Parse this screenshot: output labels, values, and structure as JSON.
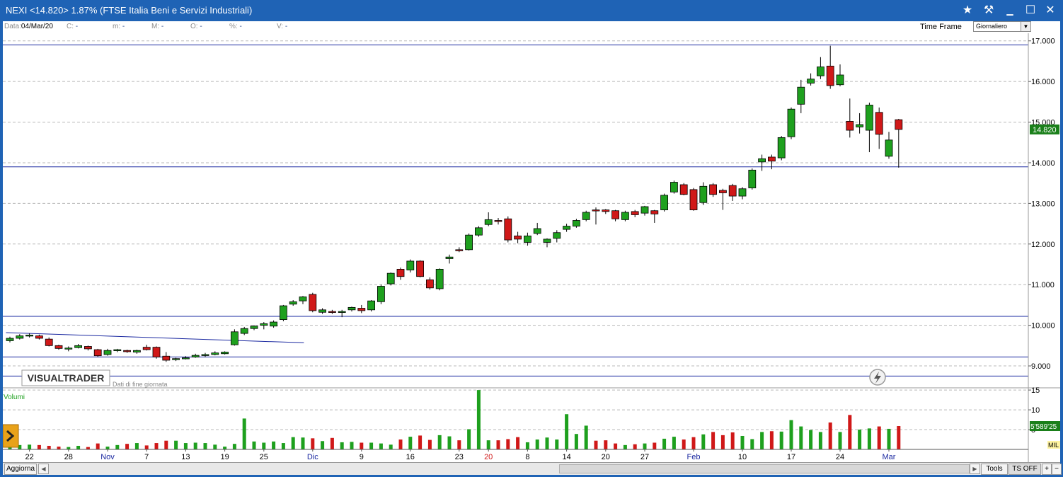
{
  "window": {
    "title": "NEXI <14.820> 1.87%  (FTSE Italia Beni e Servizi Industriali)",
    "controls": {
      "star": "★",
      "tool": "⚒",
      "minimize": "▁",
      "maximize": "☐",
      "close": "✕"
    }
  },
  "infobar": {
    "date_label": "Data:",
    "date_value": "04/Mar/20",
    "c_label": "C:",
    "c_value": "-",
    "m_low_label": "m:",
    "m_low_value": "-",
    "m_high_label": "M:",
    "m_high_value": "-",
    "o_label": "O:",
    "o_value": "-",
    "pct_label": "%:",
    "pct_value": "-",
    "v_label": "V:",
    "v_value": "-",
    "timeframe_label": "Time Frame",
    "timeframe_value": "Giornaliero"
  },
  "watermark": {
    "logo": "VISUALTRADER",
    "subtitle": "Dati di fine giornata"
  },
  "bottombar": {
    "refresh": "Aggiorna",
    "tools": "Tools",
    "ts_off": "TS OFF",
    "plus": "+",
    "minus": "−"
  },
  "colors": {
    "up": "#1ea01e",
    "down": "#d01818",
    "line": "#1a28a0",
    "grid": "#b8b8b8",
    "accent": "#1f63b5"
  },
  "chart_data": [
    {
      "type": "candlestick",
      "ylim": [
        8.6,
        17.1
      ],
      "yticks": [
        9.0,
        10.0,
        11.0,
        12.0,
        13.0,
        14.0,
        15.0,
        16.0,
        17.0
      ],
      "ytick_labels": [
        "9.000",
        "10.000",
        "11.000",
        "12.000",
        "13.000",
        "14.000",
        "15.000",
        "16.000",
        "17.000"
      ],
      "last_price_label": "14.820",
      "x_labels": [
        {
          "i": 2,
          "label": "22",
          "color": "#000"
        },
        {
          "i": 6,
          "label": "28",
          "color": "#000"
        },
        {
          "i": 10,
          "label": "Nov",
          "color": "#1a28a0"
        },
        {
          "i": 14,
          "label": "7",
          "color": "#000"
        },
        {
          "i": 18,
          "label": "13",
          "color": "#000"
        },
        {
          "i": 22,
          "label": "19",
          "color": "#000"
        },
        {
          "i": 26,
          "label": "25",
          "color": "#000"
        },
        {
          "i": 31,
          "label": "Dic",
          "color": "#1a28a0"
        },
        {
          "i": 36,
          "label": "9",
          "color": "#000"
        },
        {
          "i": 41,
          "label": "16",
          "color": "#000"
        },
        {
          "i": 46,
          "label": "23",
          "color": "#000"
        },
        {
          "i": 49,
          "label": "20",
          "color": "#d01818"
        },
        {
          "i": 53,
          "label": "8",
          "color": "#000"
        },
        {
          "i": 57,
          "label": "14",
          "color": "#000"
        },
        {
          "i": 61,
          "label": "20",
          "color": "#000"
        },
        {
          "i": 65,
          "label": "27",
          "color": "#000"
        },
        {
          "i": 70,
          "label": "Feb",
          "color": "#1a28a0"
        },
        {
          "i": 75,
          "label": "10",
          "color": "#000"
        },
        {
          "i": 80,
          "label": "17",
          "color": "#000"
        },
        {
          "i": 85,
          "label": "24",
          "color": "#000"
        },
        {
          "i": 90,
          "label": "Mar",
          "color": "#1a28a0"
        }
      ],
      "horizontal_lines": [
        16.9,
        13.9,
        10.22,
        9.22,
        8.75
      ],
      "trendline": {
        "from": [
          -0.4,
          9.82
        ],
        "to": [
          30.1,
          9.57
        ]
      },
      "ohlc": [
        [
          9.62,
          9.72,
          9.58,
          9.68
        ],
        [
          9.68,
          9.78,
          9.65,
          9.74
        ],
        [
          9.74,
          9.8,
          9.7,
          9.76
        ],
        [
          9.74,
          9.77,
          9.65,
          9.68
        ],
        [
          9.66,
          9.7,
          9.48,
          9.5
        ],
        [
          9.5,
          9.52,
          9.4,
          9.43
        ],
        [
          9.42,
          9.48,
          9.36,
          9.44
        ],
        [
          9.45,
          9.54,
          9.43,
          9.5
        ],
        [
          9.48,
          9.5,
          9.38,
          9.42
        ],
        [
          9.4,
          9.42,
          9.22,
          9.25
        ],
        [
          9.28,
          9.42,
          9.25,
          9.38
        ],
        [
          9.38,
          9.42,
          9.34,
          9.4
        ],
        [
          9.38,
          9.4,
          9.32,
          9.35
        ],
        [
          9.34,
          9.4,
          9.3,
          9.38
        ],
        [
          9.46,
          9.52,
          9.38,
          9.4
        ],
        [
          9.46,
          9.48,
          9.18,
          9.22
        ],
        [
          9.24,
          9.34,
          9.1,
          9.14
        ],
        [
          9.16,
          9.2,
          9.12,
          9.18
        ],
        [
          9.18,
          9.24,
          9.16,
          9.2
        ],
        [
          9.22,
          9.3,
          9.2,
          9.26
        ],
        [
          9.26,
          9.32,
          9.22,
          9.28
        ],
        [
          9.28,
          9.36,
          9.26,
          9.32
        ],
        [
          9.3,
          9.36,
          9.28,
          9.34
        ],
        [
          9.52,
          9.9,
          9.5,
          9.84
        ],
        [
          9.8,
          9.96,
          9.76,
          9.92
        ],
        [
          9.92,
          10.0,
          9.88,
          9.98
        ],
        [
          10.0,
          10.08,
          9.9,
          10.04
        ],
        [
          9.98,
          10.12,
          9.94,
          10.08
        ],
        [
          10.14,
          10.5,
          10.1,
          10.48
        ],
        [
          10.52,
          10.62,
          10.48,
          10.58
        ],
        [
          10.6,
          10.72,
          10.52,
          10.7
        ],
        [
          10.76,
          10.8,
          10.32,
          10.36
        ],
        [
          10.32,
          10.42,
          10.28,
          10.38
        ],
        [
          10.34,
          10.38,
          10.28,
          10.32
        ],
        [
          10.32,
          10.38,
          10.2,
          10.34
        ],
        [
          10.38,
          10.46,
          10.34,
          10.44
        ],
        [
          10.42,
          10.5,
          10.3,
          10.36
        ],
        [
          10.38,
          10.62,
          10.34,
          10.6
        ],
        [
          10.58,
          11.0,
          10.52,
          10.96
        ],
        [
          11.02,
          11.3,
          10.98,
          11.28
        ],
        [
          11.38,
          11.42,
          11.12,
          11.2
        ],
        [
          11.36,
          11.62,
          11.3,
          11.58
        ],
        [
          11.58,
          11.6,
          11.18,
          11.2
        ],
        [
          11.12,
          11.18,
          10.88,
          10.92
        ],
        [
          10.9,
          11.4,
          10.86,
          11.38
        ],
        [
          11.64,
          11.74,
          11.52,
          11.68
        ],
        [
          11.86,
          11.92,
          11.8,
          11.84
        ],
        [
          11.86,
          12.26,
          11.84,
          12.22
        ],
        [
          12.22,
          12.44,
          12.18,
          12.4
        ],
        [
          12.48,
          12.78,
          12.44,
          12.6
        ],
        [
          12.58,
          12.64,
          12.48,
          12.56
        ],
        [
          12.62,
          12.68,
          12.04,
          12.1
        ],
        [
          12.2,
          12.3,
          12.02,
          12.12
        ],
        [
          12.04,
          12.28,
          11.96,
          12.2
        ],
        [
          12.26,
          12.52,
          12.22,
          12.38
        ],
        [
          12.04,
          12.14,
          11.92,
          12.12
        ],
        [
          12.14,
          12.34,
          12.04,
          12.28
        ],
        [
          12.36,
          12.5,
          12.3,
          12.44
        ],
        [
          12.44,
          12.62,
          12.4,
          12.58
        ],
        [
          12.6,
          12.82,
          12.56,
          12.78
        ],
        [
          12.84,
          12.9,
          12.48,
          12.82
        ],
        [
          12.84,
          12.86,
          12.74,
          12.8
        ],
        [
          12.82,
          12.84,
          12.56,
          12.62
        ],
        [
          12.6,
          12.82,
          12.56,
          12.78
        ],
        [
          12.8,
          12.84,
          12.66,
          12.72
        ],
        [
          12.76,
          12.94,
          12.7,
          12.92
        ],
        [
          12.82,
          12.84,
          12.52,
          12.74
        ],
        [
          12.84,
          13.24,
          12.8,
          13.2
        ],
        [
          13.28,
          13.56,
          13.24,
          13.52
        ],
        [
          13.46,
          13.5,
          13.2,
          13.22
        ],
        [
          13.34,
          13.38,
          12.82,
          12.84
        ],
        [
          13.02,
          13.52,
          12.96,
          13.42
        ],
        [
          13.46,
          13.5,
          13.16,
          13.22
        ],
        [
          13.32,
          13.36,
          12.84,
          13.26
        ],
        [
          13.44,
          13.48,
          13.06,
          13.18
        ],
        [
          13.18,
          13.4,
          13.1,
          13.36
        ],
        [
          13.38,
          13.86,
          13.34,
          13.82
        ],
        [
          14.02,
          14.2,
          13.8,
          14.1
        ],
        [
          14.14,
          14.2,
          13.84,
          14.04
        ],
        [
          14.12,
          14.66,
          14.06,
          14.62
        ],
        [
          14.64,
          15.36,
          14.58,
          15.32
        ],
        [
          15.44,
          16.04,
          15.22,
          15.86
        ],
        [
          15.96,
          16.2,
          15.9,
          16.06
        ],
        [
          16.14,
          16.6,
          16.06,
          16.36
        ],
        [
          16.38,
          16.88,
          15.82,
          15.9
        ],
        [
          15.92,
          16.42,
          15.88,
          16.16
        ],
        [
          15.02,
          15.58,
          14.62,
          14.8
        ],
        [
          14.88,
          15.22,
          14.72,
          14.94
        ],
        [
          14.8,
          15.48,
          14.26,
          15.42
        ],
        [
          15.24,
          15.36,
          14.34,
          14.7
        ],
        [
          14.16,
          14.76,
          14.1,
          14.56
        ],
        [
          15.06,
          15.08,
          13.88,
          14.82
        ]
      ]
    },
    {
      "type": "bar",
      "title": "Volumi",
      "ylim": [
        0,
        15.2
      ],
      "yticks": [
        5,
        10,
        15
      ],
      "ytick_labels": [
        "5",
        "10",
        "15"
      ],
      "last_value_label": "5'589'25",
      "unit": "MIL",
      "values": [
        1.0,
        1.1,
        1.2,
        1.1,
        0.9,
        0.7,
        0.6,
        0.9,
        0.6,
        1.5,
        0.7,
        1.1,
        1.4,
        1.6,
        1.0,
        1.6,
        2.2,
        2.2,
        1.6,
        1.7,
        1.6,
        1.2,
        0.7,
        1.4,
        7.8,
        2.0,
        1.7,
        2.0,
        1.6,
        3.1,
        3.0,
        2.8,
        2.1,
        2.9,
        1.8,
        1.9,
        1.7,
        1.7,
        1.5,
        1.2,
        2.5,
        3.2,
        3.5,
        2.4,
        3.6,
        3.3,
        2.3,
        5.1,
        15.0,
        2.3,
        2.3,
        2.6,
        3.1,
        1.8,
        2.5,
        3.0,
        2.5,
        8.9,
        3.9,
        6.0,
        2.2,
        2.3,
        1.5,
        1.1,
        1.3,
        1.5,
        1.7,
        2.7,
        3.2,
        2.5,
        3.1,
        3.8,
        4.4,
        3.6,
        4.3,
        3.4,
        2.6,
        4.4,
        4.6,
        4.5,
        7.4,
        5.8,
        4.9,
        4.4,
        6.8,
        4.4,
        8.7,
        5.0,
        5.3,
        5.8,
        5.2,
        5.9
      ]
    }
  ]
}
